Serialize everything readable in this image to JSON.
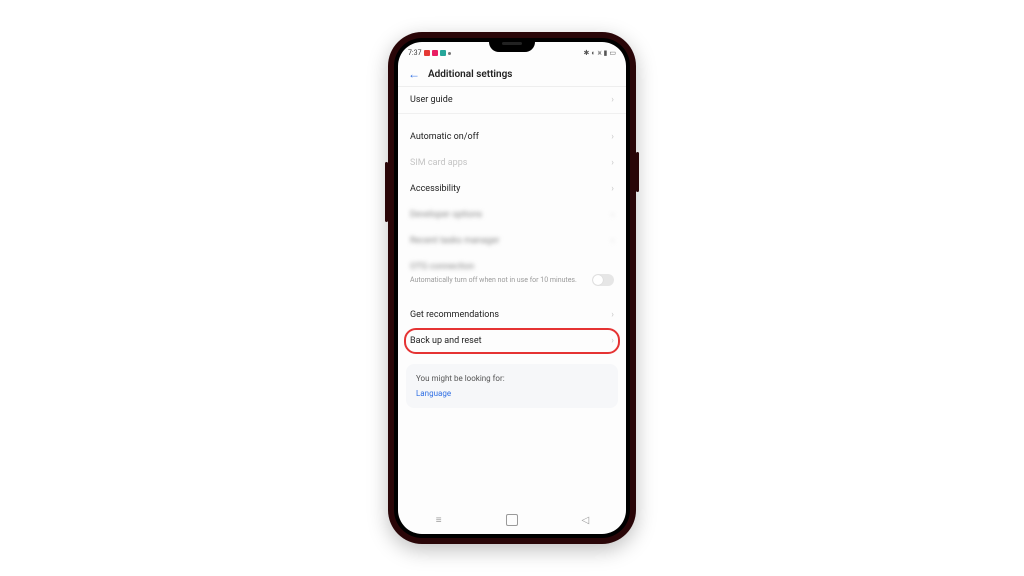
{
  "statusbar": {
    "time": "7:37"
  },
  "header": {
    "title": "Additional settings"
  },
  "rows": {
    "user_guide": "User guide",
    "auto_onoff": "Automatic on/off",
    "sim_apps": "SIM card apps",
    "accessibility": "Accessibility",
    "dev_options": "Developer options",
    "recent_tasks": "Recent tasks manager",
    "otg": "OTG connection",
    "otg_sub": "Automatically turn off when not in use for 10 minutes.",
    "recommend": "Get recommendations",
    "backup": "Back up and reset"
  },
  "card": {
    "title": "You might be looking for:",
    "link": "Language"
  }
}
